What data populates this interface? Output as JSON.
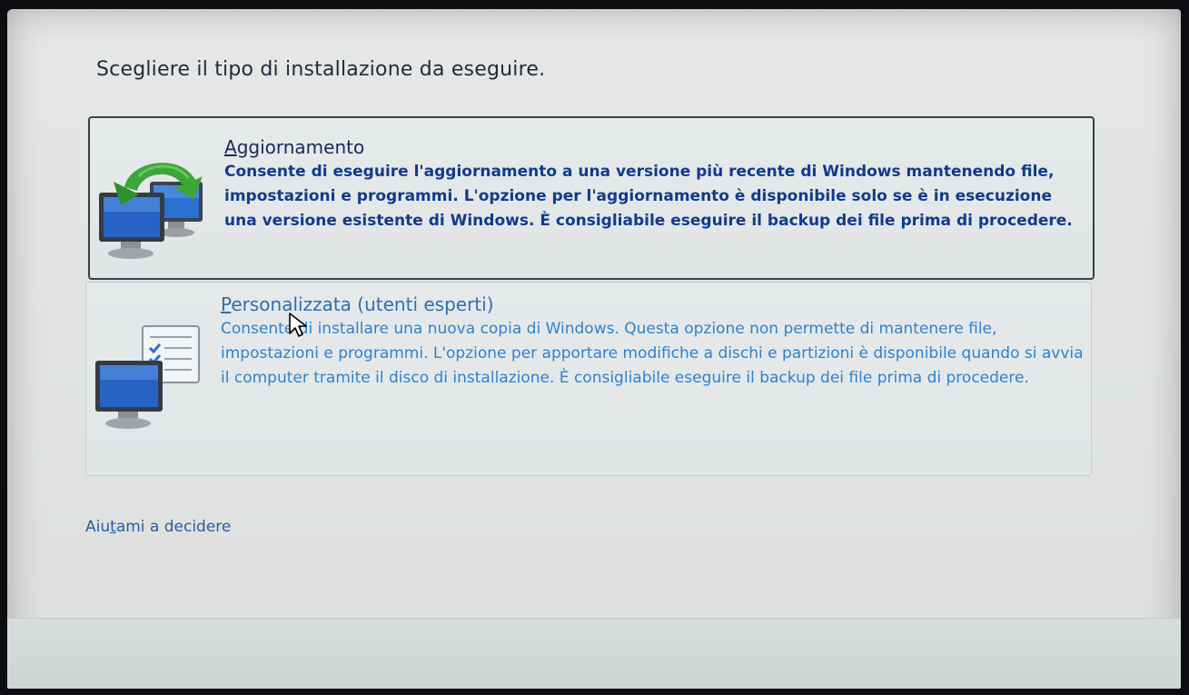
{
  "page": {
    "title": "Scegliere il tipo di installazione da eseguire."
  },
  "options": [
    {
      "id": "upgrade",
      "title_prefix": "",
      "title_accesskey": "A",
      "title_rest": "ggiornamento",
      "description": "Consente di eseguire l'aggiornamento a una versione più recente di Windows mantenendo file, impostazioni e programmi. L'opzione per l'aggiornamento è disponibile solo se è in esecuzione una versione esistente di Windows. È consigliabile eseguire il backup dei file prima di procedere.",
      "icon": "upgrade-computers-icon"
    },
    {
      "id": "custom",
      "title_prefix": "",
      "title_accesskey": "P",
      "title_rest": "ersonalizzata (utenti esperti)",
      "description": "Consente di installare una nuova copia di Windows. Questa opzione non permette di mantenere file, impostazioni e programmi. L'opzione per apportare modifiche a dischi e partizioni è disponibile quando si avvia il computer tramite il disco di installazione. È consigliabile eseguire il backup dei file prima di procedere.",
      "icon": "custom-install-computer-icon"
    }
  ],
  "help": {
    "prefix": "Aiu",
    "accesskey": "t",
    "rest": "ami a decidere"
  },
  "colors": {
    "selected_text": "#103b8c",
    "hover_text": "#2f82cc",
    "link": "#2a5da6"
  }
}
